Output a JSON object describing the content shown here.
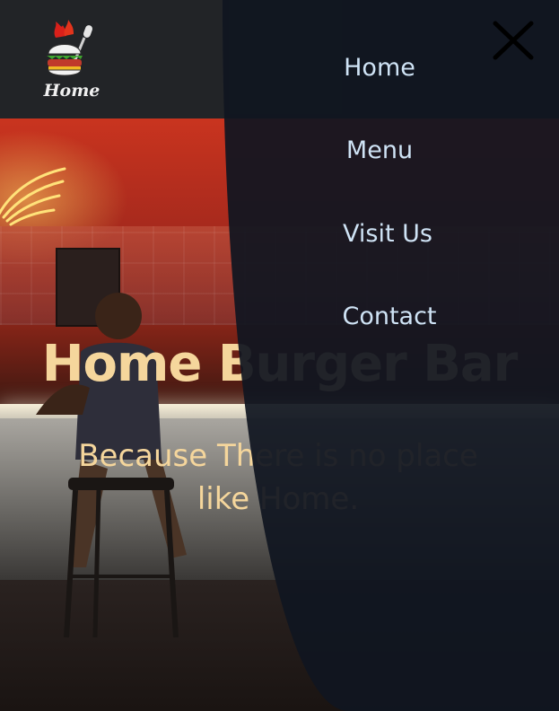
{
  "header": {
    "logo_text": "Home",
    "logo_icon": "burger-microphone-icon"
  },
  "hero": {
    "title": "Home Burger Bar",
    "tagline": "Because There is no place like Home."
  },
  "nav": {
    "items": [
      {
        "label": "Home"
      },
      {
        "label": "Menu"
      },
      {
        "label": "Visit Us"
      },
      {
        "label": "Contact"
      }
    ],
    "close_icon": "close-icon"
  },
  "colors": {
    "overlay": "#101620",
    "nav_text": "#cfe3f5",
    "hero_text": "#f5d69c",
    "header_bg": "#222427"
  }
}
